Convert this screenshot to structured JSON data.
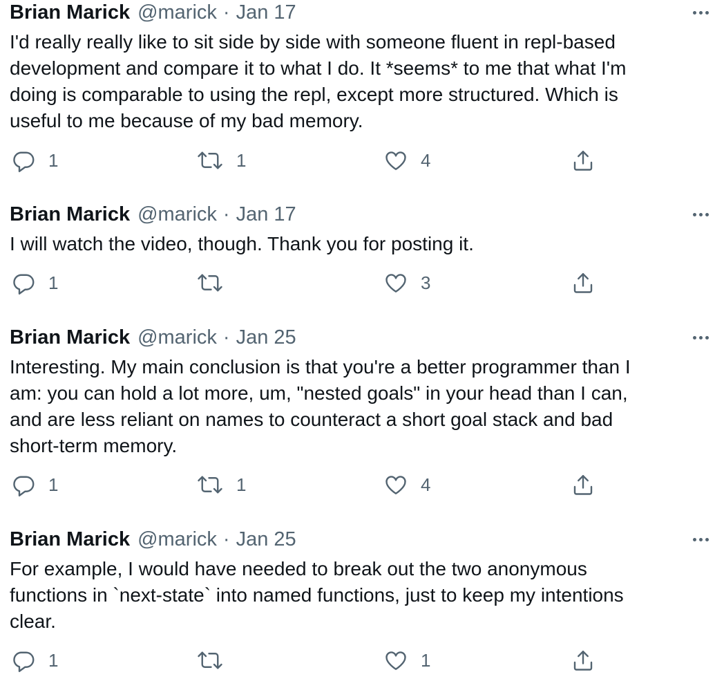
{
  "tweets": [
    {
      "name": "Brian Marick",
      "handle": "@marick",
      "separator": "·",
      "date": "Jan 17",
      "text": "I'd really really like to sit side by side with someone fluent in repl-based\ndevelopment and compare it to what I do. It *seems* to me that what I'm\ndoing is comparable to using the repl, except more structured. Which is\nuseful to me because of my bad memory.",
      "replies": "1",
      "retweets": "1",
      "likes": "4"
    },
    {
      "name": "Brian Marick",
      "handle": "@marick",
      "separator": "·",
      "date": "Jan 17",
      "text": "I will watch the video, though. Thank you for posting it.",
      "replies": "1",
      "retweets": "",
      "likes": "3"
    },
    {
      "name": "Brian Marick",
      "handle": "@marick",
      "separator": "·",
      "date": "Jan 25",
      "text": "Interesting. My main conclusion is that you're a better programmer than I\nam: you can hold a lot more, um, \"nested goals\" in your head than I can,\nand are less reliant on names to counteract a short goal stack and bad\nshort-term memory.",
      "replies": "1",
      "retweets": "1",
      "likes": "4"
    },
    {
      "name": "Brian Marick",
      "handle": "@marick",
      "separator": "·",
      "date": "Jan 25",
      "text": "For example, I would have needed to break out the two anonymous\nfunctions in `next-state` into named functions, just to keep my intentions\nclear.",
      "replies": "1",
      "retweets": "",
      "likes": "1"
    }
  ],
  "icons": {
    "more": "more-icon",
    "reply": "reply-icon",
    "retweet": "retweet-icon",
    "like": "like-icon",
    "share": "share-icon"
  },
  "colors": {
    "text": "#0f1419",
    "secondary": "#536471",
    "background": "#ffffff"
  }
}
